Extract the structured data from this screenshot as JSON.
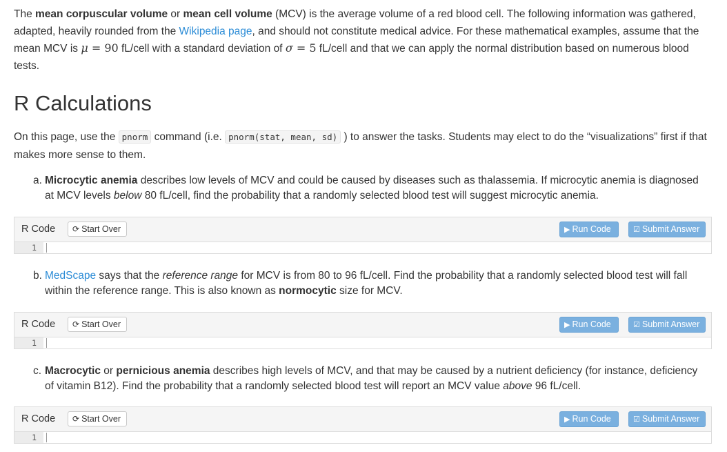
{
  "intro": {
    "t1": "The ",
    "b1": "mean corpuscular volume",
    "t2": " or ",
    "b2": "mean cell volume",
    "t3": " (MCV) is the average volume of a red blood cell. The following information was gathered, adapted, heavily rounded from the ",
    "link": "Wikipedia page",
    "t4": ", and should not constitute medical advice. For these mathematical examples, assume that the mean MCV is ",
    "mu_sym": "μ",
    "mu_eq": " = 90",
    "t5": " fL/cell with a standard deviation of ",
    "sigma_sym": "σ",
    "sigma_eq": " = 5",
    "t6": " fL/cell and that we can apply the normal distribution based on numerous blood tests."
  },
  "section_title": "R Calculations",
  "desc": {
    "t1": "On this page, use the ",
    "code1": "pnorm",
    "t2": " command (i.e. ",
    "code2": "pnorm(stat, mean, sd)",
    "t3": " ) to answer the tasks. Students may elect to do the “visualizations” first if that makes more sense to them."
  },
  "tasks": [
    {
      "label": "a.",
      "b1": "Microcytic anemia",
      "t1": " describes low levels of MCV and could be caused by diseases such as thalassemia. If microcytic anemia is diagnosed",
      "t2": "at MCV levels ",
      "i1": "below",
      "t3": " 80 fL/cell, find the probability that a randomly selected blood test will suggest microcytic anemia."
    },
    {
      "label": "b.",
      "link": "MedScape",
      "t1": " says that the ",
      "i1": "reference range",
      "t2": " for MCV is from 80 to 96 fL/cell. Find the probability that a randomly selected blood test will fall",
      "t3": "within the reference range. This is also known as ",
      "b1": "normocytic",
      "t4": " size for MCV."
    },
    {
      "label": "c.",
      "b1": "Macrocytic",
      "t1": " or ",
      "b2": "pernicious anemia",
      "t2": " describes high levels of MCV, and that may be caused by a nutrient deficiency (for instance, deficiency",
      "t3": "of vitamin B12). Find the probability that a randomly selected blood test will report an MCV value ",
      "i1": "above",
      "t4": " 96 fL/cell."
    }
  ],
  "editor": {
    "title": "R Code",
    "start_over": "Start Over",
    "run_code": "Run Code",
    "submit_answer": "Submit Answer",
    "line_number": "1"
  },
  "icons": {
    "start_over": "refresh-icon",
    "run_code": "play-icon",
    "submit_answer": "check-square-icon"
  },
  "colors": {
    "link": "#2a8bd6",
    "button_blue": "#7ab0df"
  }
}
